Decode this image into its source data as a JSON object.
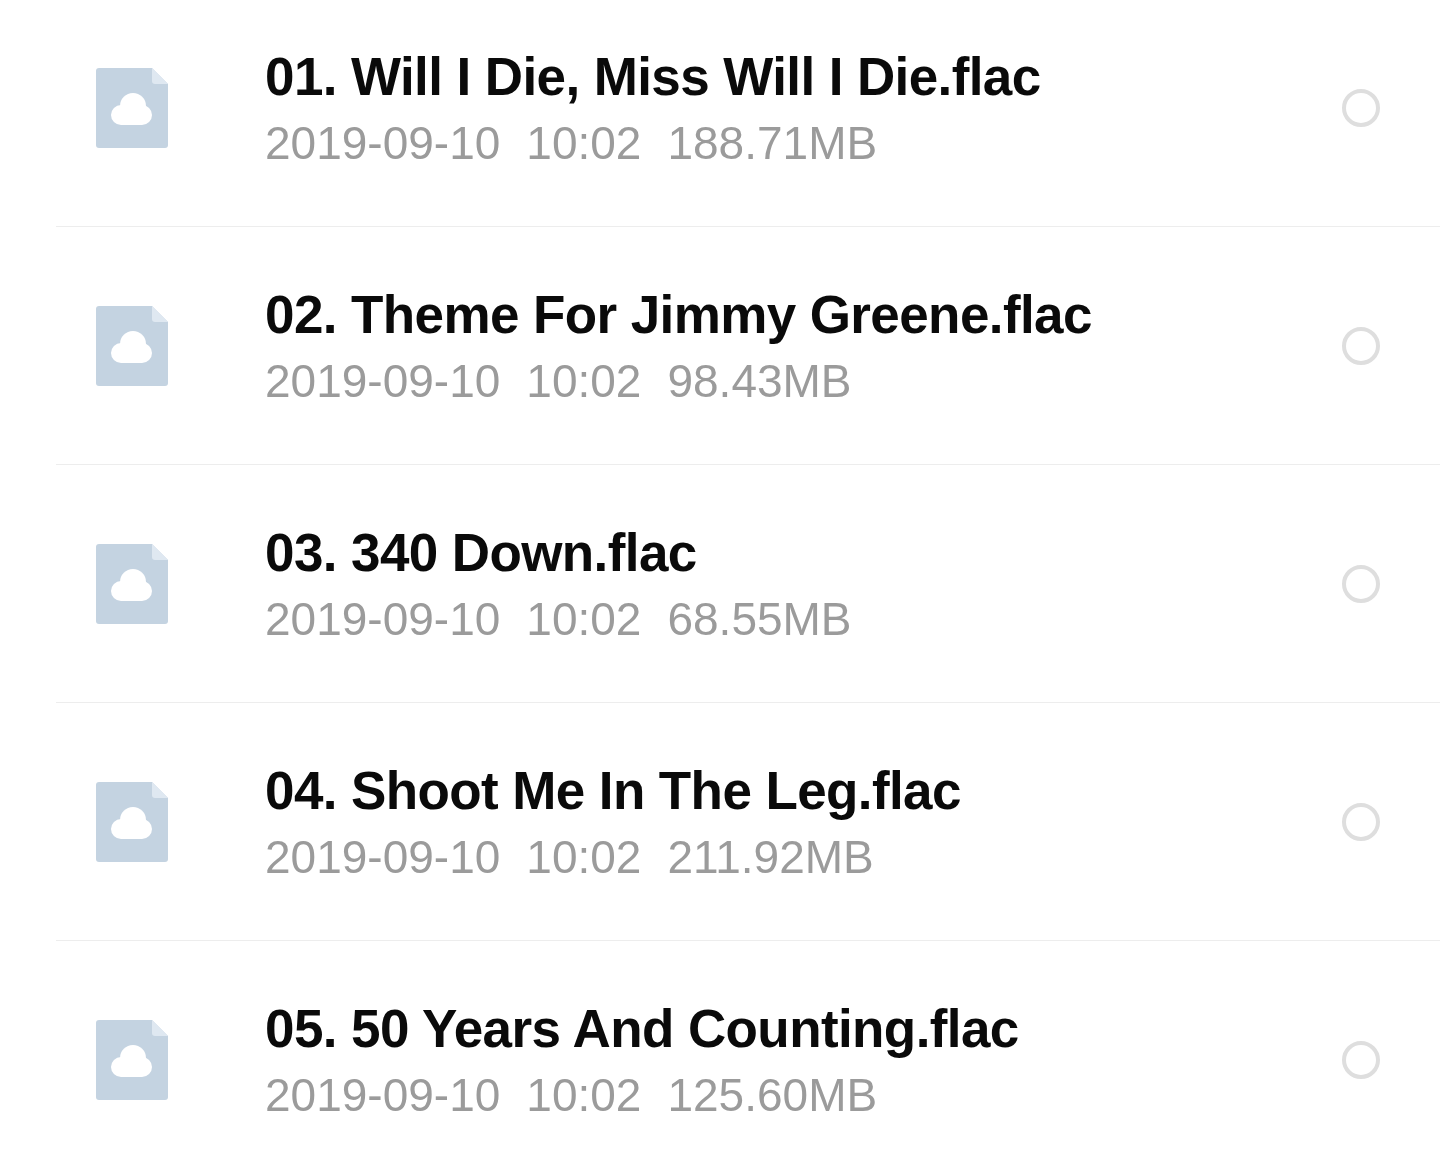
{
  "files": [
    {
      "name": "01. Will I Die, Miss Will I Die.flac",
      "date": "2019-09-10",
      "time": "10:02",
      "size": "188.71MB",
      "selected": false
    },
    {
      "name": "02. Theme For Jimmy Greene.flac",
      "date": "2019-09-10",
      "time": "10:02",
      "size": "98.43MB",
      "selected": false
    },
    {
      "name": "03. 340 Down.flac",
      "date": "2019-09-10",
      "time": "10:02",
      "size": "68.55MB",
      "selected": false
    },
    {
      "name": "04. Shoot Me In The Leg.flac",
      "date": "2019-09-10",
      "time": "10:02",
      "size": "211.92MB",
      "selected": false
    },
    {
      "name": "05. 50 Years And Counting.flac",
      "date": "2019-09-10",
      "time": "10:02",
      "size": "125.60MB",
      "selected": false
    }
  ]
}
